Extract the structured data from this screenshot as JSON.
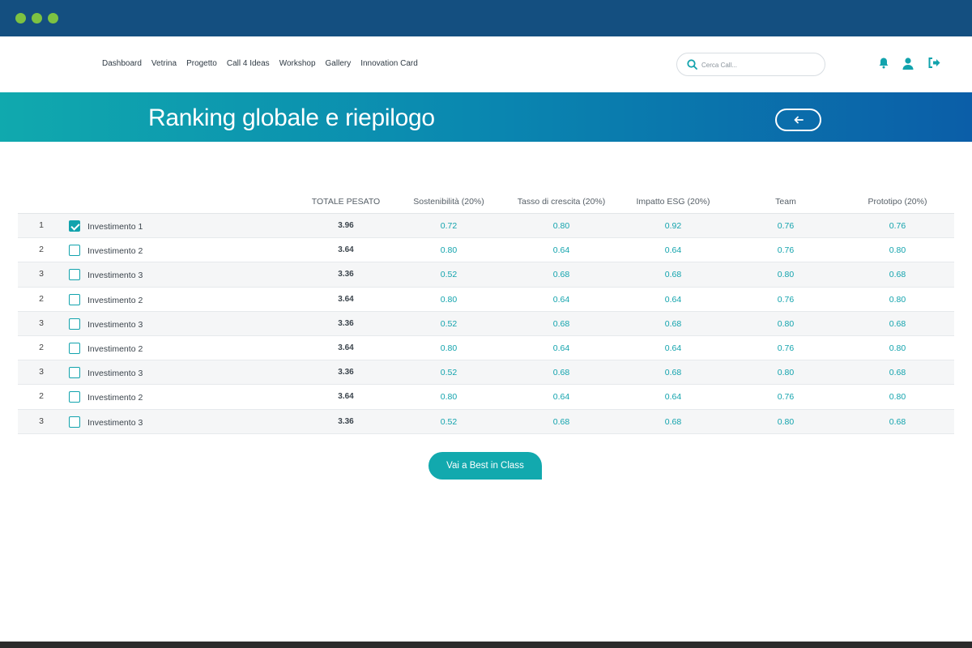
{
  "nav": {
    "items": [
      "Dashboard",
      "Vetrina",
      "Progetto",
      "Call 4 Ideas",
      "Workshop",
      "Gallery",
      "Innovation Card"
    ],
    "search_placeholder": "Cerca Call..."
  },
  "banner": {
    "title": "Ranking globale e riepilogo"
  },
  "table": {
    "columns": [
      "TOTALE PESATO",
      "Sostenibilità (20%)",
      "Tasso di crescita (20%)",
      "Impatto ESG (20%)",
      "Team",
      "Prototipo (20%)"
    ],
    "rows": [
      {
        "rank": "1",
        "checked": true,
        "name": "Investimento 1",
        "total": "3.96",
        "scores": [
          "0.72",
          "0.80",
          "0.92",
          "0.76",
          "0.76"
        ]
      },
      {
        "rank": "2",
        "checked": false,
        "name": "Investimento 2",
        "total": "3.64",
        "scores": [
          "0.80",
          "0.64",
          "0.64",
          "0.76",
          "0.80"
        ]
      },
      {
        "rank": "3",
        "checked": false,
        "name": "Investimento 3",
        "total": "3.36",
        "scores": [
          "0.52",
          "0.68",
          "0.68",
          "0.80",
          "0.68"
        ]
      },
      {
        "rank": "2",
        "checked": false,
        "name": "Investimento 2",
        "total": "3.64",
        "scores": [
          "0.80",
          "0.64",
          "0.64",
          "0.76",
          "0.80"
        ]
      },
      {
        "rank": "3",
        "checked": false,
        "name": "Investimento 3",
        "total": "3.36",
        "scores": [
          "0.52",
          "0.68",
          "0.68",
          "0.80",
          "0.68"
        ]
      },
      {
        "rank": "2",
        "checked": false,
        "name": "Investimento 2",
        "total": "3.64",
        "scores": [
          "0.80",
          "0.64",
          "0.64",
          "0.76",
          "0.80"
        ]
      },
      {
        "rank": "3",
        "checked": false,
        "name": "Investimento 3",
        "total": "3.36",
        "scores": [
          "0.52",
          "0.68",
          "0.68",
          "0.80",
          "0.68"
        ]
      },
      {
        "rank": "2",
        "checked": false,
        "name": "Investimento 2",
        "total": "3.64",
        "scores": [
          "0.80",
          "0.64",
          "0.64",
          "0.76",
          "0.80"
        ]
      },
      {
        "rank": "3",
        "checked": false,
        "name": "Investimento 3",
        "total": "3.36",
        "scores": [
          "0.52",
          "0.68",
          "0.68",
          "0.80",
          "0.68"
        ]
      }
    ]
  },
  "cta": {
    "label": "Vai a Best in Class"
  },
  "icons": {
    "window_dots": [
      "window-dot-icon",
      "window-dot-icon",
      "window-dot-icon"
    ],
    "search": "search-icon",
    "notifications": "bell-icon",
    "profile": "user-icon",
    "logout": "logout-icon",
    "back": "arrow-left-icon"
  },
  "colors": {
    "chrome": "#144f80",
    "window_dot": "#7dc242",
    "accent": "#12a3ad",
    "banner_start": "#10a9ae",
    "banner_end": "#0b5ea8"
  }
}
